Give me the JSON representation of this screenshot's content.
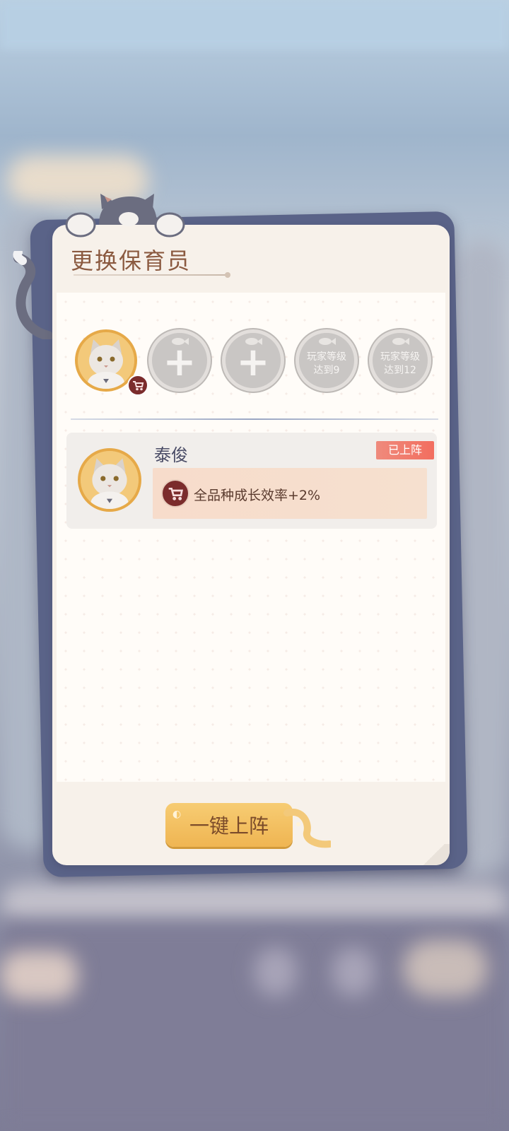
{
  "dialog": {
    "title": "更换保育员",
    "slots": [
      {
        "state": "filled",
        "icon": "cat-portrait"
      },
      {
        "state": "empty",
        "label": "+"
      },
      {
        "state": "empty",
        "label": "+"
      },
      {
        "state": "locked",
        "label_line1": "玩家等级",
        "label_line2": "达到9"
      },
      {
        "state": "locked",
        "label_line1": "玩家等级",
        "label_line2": "达到12"
      }
    ],
    "nanny": {
      "name": "泰俊",
      "status": "已上阵",
      "bonus": "全品种成长效率+2%",
      "bonus_icon": "stroller-icon"
    },
    "deploy_button": "一键上阵"
  },
  "colors": {
    "accent": "#efb552",
    "title": "#8b5a40",
    "badge": "#f26e5f",
    "frame": "#5a6388"
  }
}
